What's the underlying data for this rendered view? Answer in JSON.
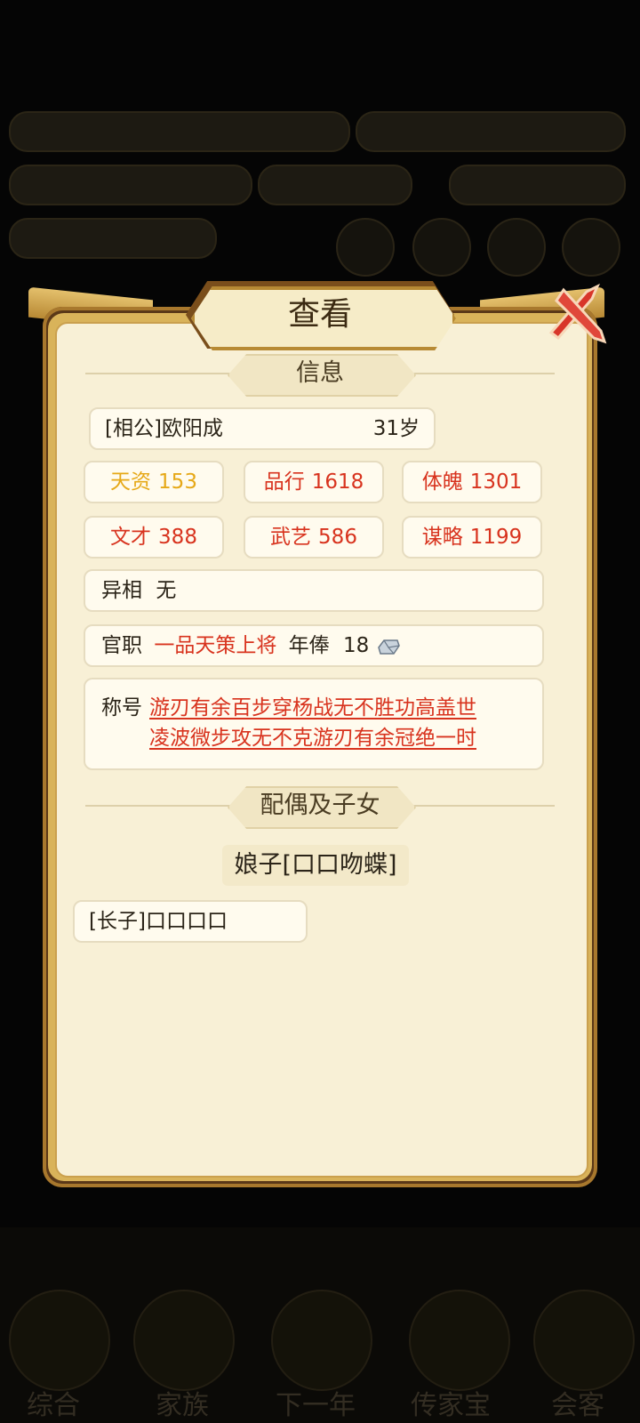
{
  "dialog": {
    "title": "查看",
    "section_info": "信息",
    "section_family": "配偶及子女"
  },
  "person": {
    "name_line": "[相公]欧阳成",
    "age": "31岁"
  },
  "stats": [
    {
      "label": "天资",
      "value": "153",
      "color": "#e6a817"
    },
    {
      "label": "品行",
      "value": "1618",
      "color": "#d8331e"
    },
    {
      "label": "体魄",
      "value": "1301",
      "color": "#d8331e"
    },
    {
      "label": "文才",
      "value": "388",
      "color": "#d8331e"
    },
    {
      "label": "武艺",
      "value": "586",
      "color": "#d8331e"
    },
    {
      "label": "谋略",
      "value": "1199",
      "color": "#d8331e"
    }
  ],
  "yixiang": {
    "label": "异相",
    "value": "无"
  },
  "office": {
    "label": "官职",
    "value": "一品天策上将",
    "salary_label": "年俸",
    "salary_value": "18",
    "salary_icon": "silver-ingot-icon"
  },
  "titles": {
    "label": "称号",
    "line1": "游刃有余百步穿杨战无不胜功高盖世",
    "line2": "凌波微步攻无不克游刃有余冠绝一时"
  },
  "spouse": "娘子[口口吻蝶]",
  "children": [
    "[长子]口口口口"
  ],
  "background_ui": {
    "nav_labels": [
      "综合",
      "家族",
      "下一年",
      "传家宝",
      "会客"
    ]
  }
}
